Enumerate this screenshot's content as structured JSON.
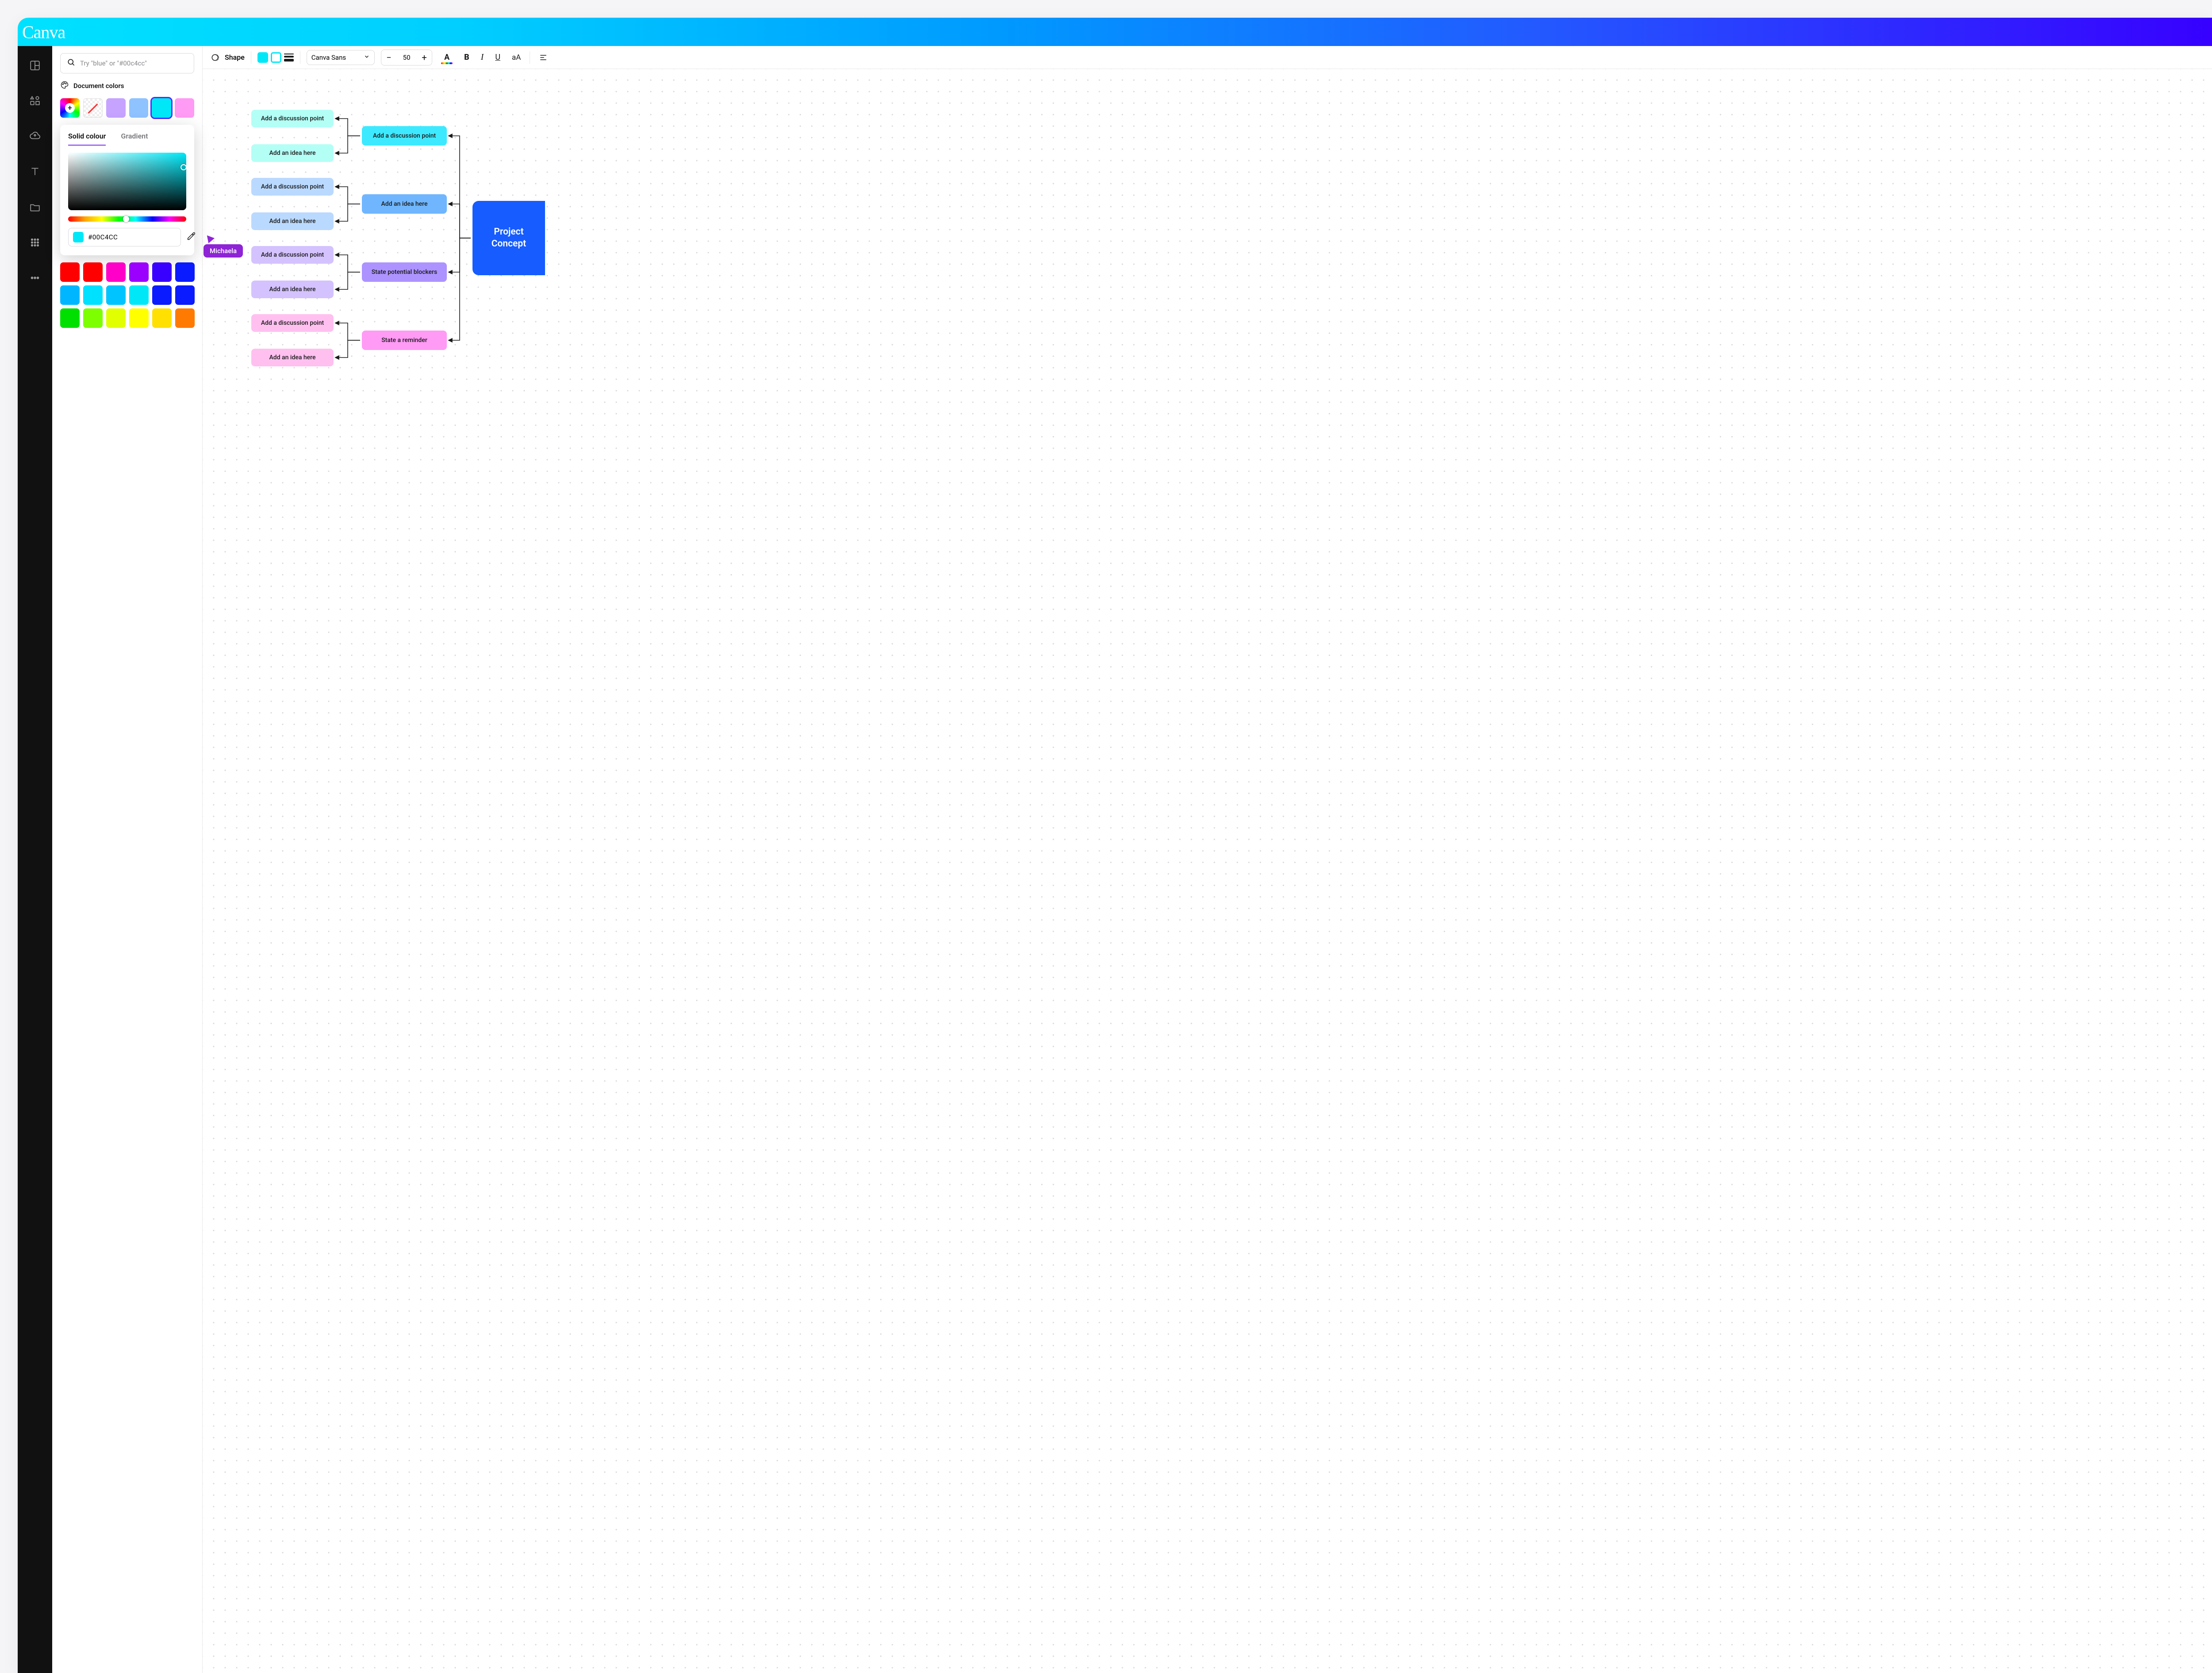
{
  "app": {
    "brand": "Canva"
  },
  "search": {
    "placeholder": "Try \"blue\" or \"#00c4cc\""
  },
  "side": {
    "doc_colors_label": "Document colors",
    "doc_swatches": [
      {
        "kind": "add",
        "name": "add-color"
      },
      {
        "kind": "none",
        "name": "no-color"
      },
      {
        "color": "#c6a3ff",
        "name": "lavender"
      },
      {
        "color": "#8fc3ff",
        "name": "light-blue"
      },
      {
        "color": "#00e8f8",
        "name": "cyan",
        "selected": true
      },
      {
        "color": "#ff9af5",
        "name": "pink"
      }
    ],
    "default_swatches": [
      "#ff0000",
      "#ff0000",
      "#ff00c8",
      "#9b00ff",
      "#3800ff",
      "#0a1bff",
      "#00b7ff",
      "#00e0ff",
      "#00c4ff",
      "#00e8f8",
      "#0a1bff",
      "#0a1bff",
      "#00e000",
      "#7dff00",
      "#e2ff00",
      "#ffff00",
      "#ffe000",
      "#ff7a00"
    ]
  },
  "picker": {
    "tab_solid": "Solid colour",
    "tab_gradient": "Gradient",
    "hex": "#00C4CC",
    "chip_color": "#00e8f8"
  },
  "collab": {
    "name": "Michaela"
  },
  "toolbar": {
    "shape_label": "Shape",
    "font_label": "Canva Sans",
    "font_size": "50",
    "fill_color": "#00e8f8"
  },
  "diagram": {
    "root": "Project Concept",
    "groups": [
      {
        "branch": "Add a discussion point",
        "leaves": [
          "Add a discussion point",
          "Add an idea here"
        ],
        "leafColor": "#b3fff6",
        "branchColor": "#3de9ff"
      },
      {
        "branch": "Add an idea here",
        "leaves": [
          "Add a discussion point",
          "Add an idea here"
        ],
        "leafColor": "#bad9ff",
        "branchColor": "#6fb6ff"
      },
      {
        "branch": "State potential blockers",
        "leaves": [
          "Add a discussion point",
          "Add an idea here"
        ],
        "leafColor": "#d4c2ff",
        "branchColor": "#ac93ff"
      },
      {
        "branch": "State a reminder",
        "leaves": [
          "Add a discussion point",
          "Add an idea here"
        ],
        "leafColor": "#ffc0f0",
        "branchColor": "#ff9af5"
      }
    ],
    "root_color": "#165cff"
  }
}
